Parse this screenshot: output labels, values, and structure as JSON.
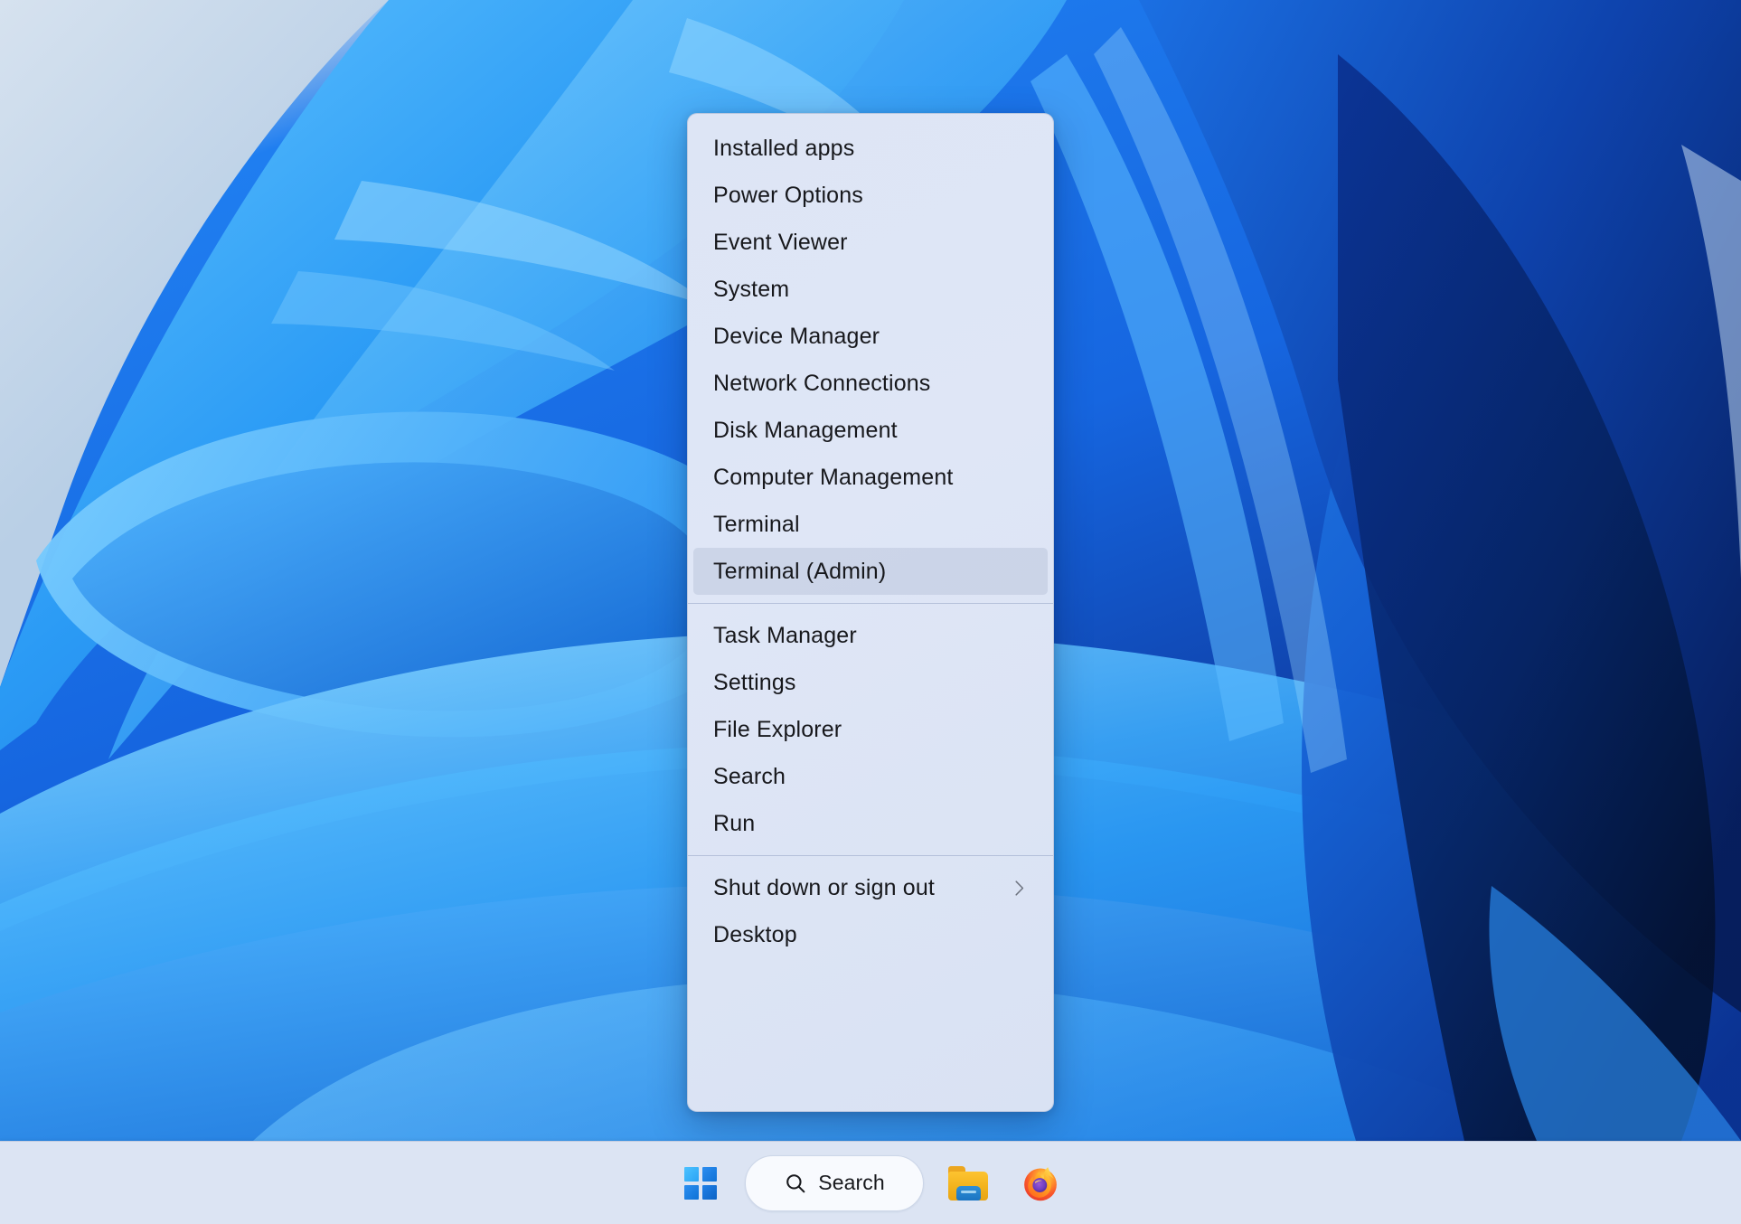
{
  "desktop": {
    "wallpaper_name": "windows-11-bloom-wallpaper",
    "colors": {
      "light_edge": "#cfdcec",
      "bright_blue": "#2b9bf5",
      "mid_blue": "#1668e2",
      "deep_blue": "#0b3496",
      "navy": "#061a52"
    }
  },
  "winx_menu": {
    "name": "Win+X quick link menu",
    "groups": [
      {
        "items": [
          {
            "label": "Installed apps",
            "submenu": false,
            "highlighted": false
          },
          {
            "label": "Power Options",
            "submenu": false,
            "highlighted": false
          },
          {
            "label": "Event Viewer",
            "submenu": false,
            "highlighted": false
          },
          {
            "label": "System",
            "submenu": false,
            "highlighted": false
          },
          {
            "label": "Device Manager",
            "submenu": false,
            "highlighted": false
          },
          {
            "label": "Network Connections",
            "submenu": false,
            "highlighted": false
          },
          {
            "label": "Disk Management",
            "submenu": false,
            "highlighted": false
          },
          {
            "label": "Computer Management",
            "submenu": false,
            "highlighted": false
          },
          {
            "label": "Terminal",
            "submenu": false,
            "highlighted": false
          },
          {
            "label": "Terminal (Admin)",
            "submenu": false,
            "highlighted": true
          }
        ]
      },
      {
        "items": [
          {
            "label": "Task Manager",
            "submenu": false,
            "highlighted": false
          },
          {
            "label": "Settings",
            "submenu": false,
            "highlighted": false
          },
          {
            "label": "File Explorer",
            "submenu": false,
            "highlighted": false
          },
          {
            "label": "Search",
            "submenu": false,
            "highlighted": false
          },
          {
            "label": "Run",
            "submenu": false,
            "highlighted": false
          }
        ]
      },
      {
        "items": [
          {
            "label": "Shut down or sign out",
            "submenu": true,
            "highlighted": false
          },
          {
            "label": "Desktop",
            "submenu": false,
            "highlighted": false
          }
        ]
      }
    ],
    "highlight_color": "#96a5c3",
    "background_color": "#dde5f5",
    "text_color": "#17181c"
  },
  "taskbar": {
    "background_color": "#dce4f3",
    "start_button": {
      "icon": "windows-logo-icon",
      "tooltip": "Start"
    },
    "search": {
      "icon": "search-icon",
      "placeholder": "Search",
      "label": "Search"
    },
    "pinned": [
      {
        "name": "file-explorer",
        "icon": "folder-icon",
        "label": "File Explorer"
      },
      {
        "name": "firefox",
        "icon": "firefox-icon",
        "label": "Firefox"
      }
    ]
  }
}
